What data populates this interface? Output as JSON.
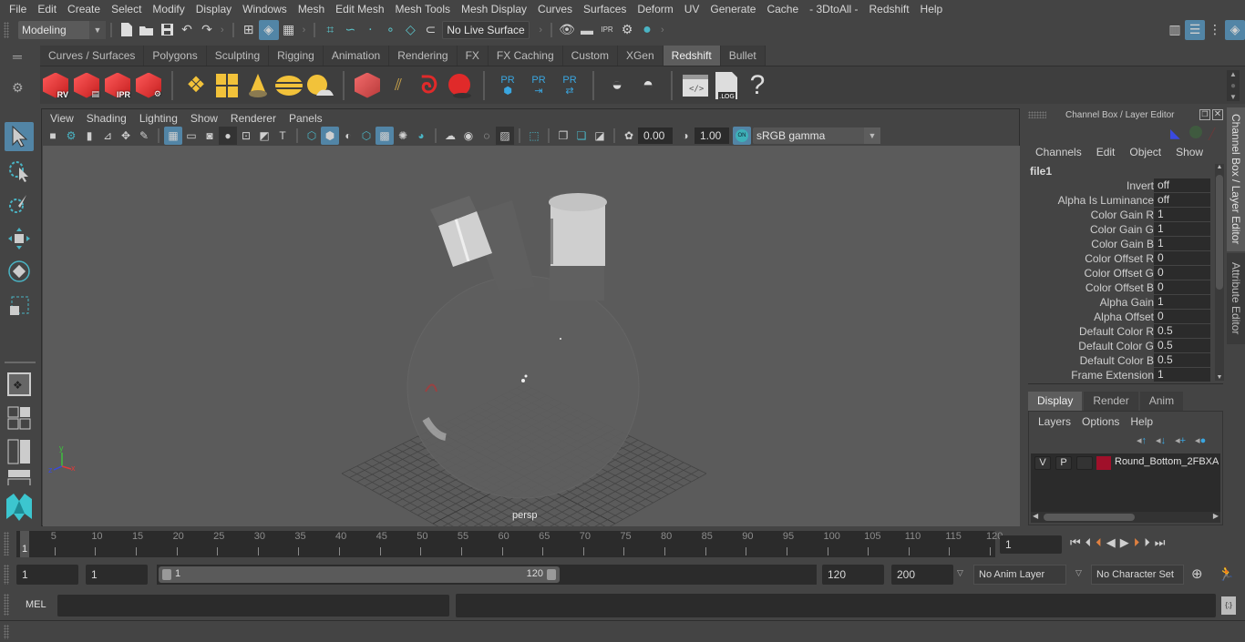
{
  "menubar": {
    "items": [
      "File",
      "Edit",
      "Create",
      "Select",
      "Modify",
      "Display",
      "Windows",
      "Mesh",
      "Edit Mesh",
      "Mesh Tools",
      "Mesh Display",
      "Curves",
      "Surfaces",
      "Deform",
      "UV",
      "Generate",
      "Cache",
      "- 3DtoAll -",
      "Redshift",
      "Help"
    ]
  },
  "statusline": {
    "mode_dropdown": "Modeling",
    "live_surface": "No Live Surface"
  },
  "shelf": {
    "tabs": [
      "Curves / Surfaces",
      "Polygons",
      "Sculpting",
      "Rigging",
      "Animation",
      "Rendering",
      "FX",
      "FX Caching",
      "Custom",
      "XGen",
      "Redshift",
      "Bullet"
    ],
    "active_tab": "Redshift",
    "icons": {
      "rv": "RV",
      "ipr": "IPR",
      "pr": "PR",
      "log": ".LOG",
      "help": "?"
    }
  },
  "viewport": {
    "menu": [
      "View",
      "Shading",
      "Lighting",
      "Show",
      "Renderer",
      "Panels"
    ],
    "exposure": "0.00",
    "gamma": "1.00",
    "color_mgmt_toggle": "ON",
    "color_space": "sRGB gamma",
    "camera_label": "persp",
    "axis": {
      "x": "x",
      "y": "y",
      "z": "z"
    }
  },
  "channel_box": {
    "title": "Channel Box / Layer Editor",
    "menu": [
      "Channels",
      "Edit",
      "Object",
      "Show"
    ],
    "node_name": "file1",
    "attributes": [
      {
        "label": "Invert",
        "value": "off"
      },
      {
        "label": "Alpha Is Luminance",
        "value": "off"
      },
      {
        "label": "Color Gain R",
        "value": "1"
      },
      {
        "label": "Color Gain G",
        "value": "1"
      },
      {
        "label": "Color Gain B",
        "value": "1"
      },
      {
        "label": "Color Offset R",
        "value": "0"
      },
      {
        "label": "Color Offset G",
        "value": "0"
      },
      {
        "label": "Color Offset B",
        "value": "0"
      },
      {
        "label": "Alpha Gain",
        "value": "1"
      },
      {
        "label": "Alpha Offset",
        "value": "0"
      },
      {
        "label": "Default Color R",
        "value": "0.5"
      },
      {
        "label": "Default Color G",
        "value": "0.5"
      },
      {
        "label": "Default Color B",
        "value": "0.5"
      },
      {
        "label": "Frame Extension",
        "value": "1"
      }
    ]
  },
  "layer_editor": {
    "tabs": [
      "Display",
      "Render",
      "Anim"
    ],
    "active_tab": "Display",
    "menu": [
      "Layers",
      "Options",
      "Help"
    ],
    "layers": [
      {
        "visible": "V",
        "playback": "P",
        "color": "#a0102a",
        "name": "Round_Bottom_2FBXA"
      }
    ]
  },
  "side_tabs": [
    "Channel Box / Layer Editor",
    "Attribute Editor"
  ],
  "timeline": {
    "ticks": [
      5,
      10,
      15,
      20,
      25,
      30,
      35,
      40,
      45,
      50,
      55,
      60,
      65,
      70,
      75,
      80,
      85,
      90,
      95,
      100,
      105,
      110,
      115,
      120
    ],
    "start": 1,
    "end": 120,
    "current_frame_marker": "1",
    "current_frame_field": "1"
  },
  "range": {
    "start_time": "1",
    "playback_start": "1",
    "slider_start": "1",
    "slider_end": "120",
    "playback_end": "120",
    "end_time": "200",
    "anim_layer": "No Anim Layer",
    "character_set": "No Character Set"
  },
  "cmdline": {
    "language": "MEL",
    "input_value": "",
    "result_value": ""
  },
  "colors": {
    "accent": "#5285a6",
    "bg": "#444444",
    "field": "#2b2b2b",
    "viewport": "#5b5b5b",
    "redshift_red": "#e02a2a",
    "playhead": "#e08040"
  }
}
